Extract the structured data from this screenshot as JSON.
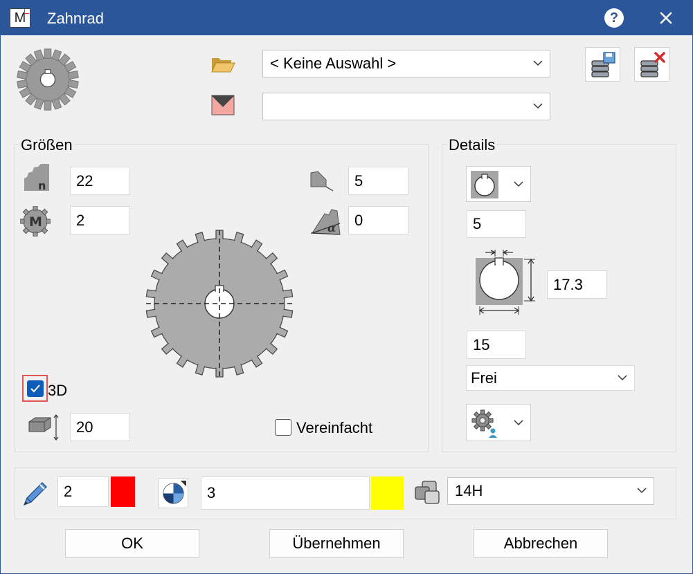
{
  "window": {
    "title": "Zahnrad",
    "help_label": "?"
  },
  "app_icon_letter": "M",
  "header": {
    "selection_value": "< Keine Auswahl >",
    "second_combo_value": ""
  },
  "groessen": {
    "label": "Größen",
    "teeth_count": "22",
    "module": "2",
    "tooth_value": "5",
    "angle_value": "0",
    "thickness": "20",
    "checkbox_3d_label": "3D",
    "checkbox_3d_checked": true,
    "simplified_label": "Vereinfacht",
    "simplified_checked": false
  },
  "details": {
    "label": "Details",
    "keyway_width": "5",
    "keyway_height": "17.3",
    "bore_diameter": "15",
    "mode_value": "Frei"
  },
  "footer": {
    "line_width": "2",
    "line_color": "#ff0000",
    "pattern_value": "3",
    "fill_color": "#ffff00",
    "layer_value": "14H"
  },
  "buttons": {
    "ok": "OK",
    "apply": "Übernehmen",
    "cancel": "Abbrechen"
  },
  "icons": {
    "gear": "gear-icon",
    "folder": "folder-open-icon",
    "mail": "envelope-icon",
    "save_db": "save-database-icon",
    "delete_db": "delete-database-icon"
  },
  "colors": {
    "titlebar": "#2b579a",
    "checkbox_accent": "#0f5db8"
  }
}
